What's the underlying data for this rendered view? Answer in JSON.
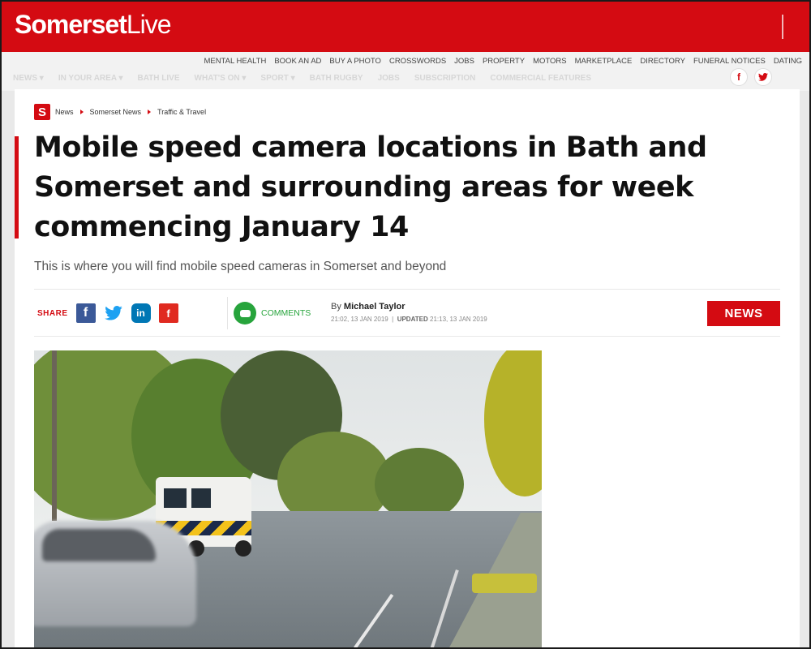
{
  "header": {
    "logo_part1": "Somerset",
    "logo_part2": "Live"
  },
  "util_links": [
    "MENTAL HEALTH",
    "BOOK AN AD",
    "BUY A PHOTO",
    "CROSSWORDS",
    "JOBS",
    "PROPERTY",
    "MOTORS",
    "MARKETPLACE",
    "DIRECTORY",
    "FUNERAL NOTICES",
    "DATING"
  ],
  "faded_nav": [
    "NEWS ▾",
    "IN YOUR AREA ▾",
    "BATH LIVE",
    "WHAT'S ON ▾",
    "SPORT ▾",
    "BATH RUGBY",
    "JOBS",
    "SUBSCRIPTION",
    "COMMERCIAL FEATURES"
  ],
  "social_top": {
    "facebook": "f",
    "twitter": "𝕥"
  },
  "breadcrumb": {
    "badge": "S",
    "items": [
      "News",
      "Somerset News",
      "Traffic & Travel"
    ]
  },
  "article": {
    "headline": "Mobile speed camera locations in Bath and Somerset and surrounding areas for week commencing January 14",
    "standfirst": "This is where you will find mobile speed cameras in Somerset and beyond",
    "share_label": "SHARE",
    "comments_label": "COMMENTS",
    "by_prefix": "By",
    "author": "Michael Taylor",
    "published": "21:02, 13 JAN 2019",
    "updated_label": "UPDATED",
    "updated": "21:13, 13 JAN 2019",
    "tag": "NEWS"
  },
  "share_icons": {
    "facebook": "f",
    "twitter": "🐦",
    "linkedin": "in",
    "flipboard": "f"
  },
  "colors": {
    "brand_red": "#d40b12",
    "comments_green": "#27a43c"
  }
}
